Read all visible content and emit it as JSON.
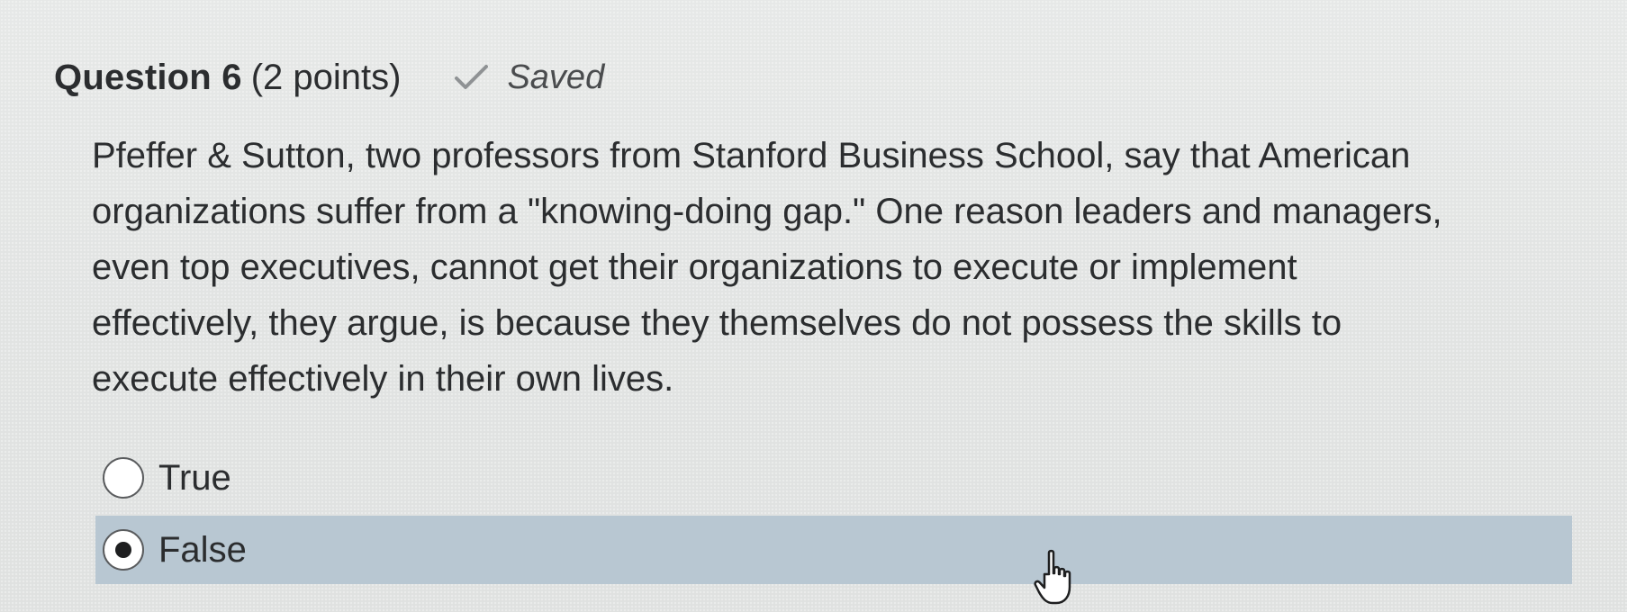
{
  "question": {
    "title": "Question 6",
    "points": "(2 points)",
    "status": "Saved",
    "status_icon": "check-icon",
    "text_lines": [
      "Pfeffer & Sutton, two professors from Stanford Business School, say that American",
      "organizations suffer from a \"knowing-doing gap.\" One reason leaders and managers,",
      "even top executives, cannot get their organizations to execute or implement",
      "effectively, they argue, is because they themselves do not possess the skills to",
      "execute effectively in their own lives."
    ]
  },
  "options": [
    {
      "label": "True",
      "selected": false
    },
    {
      "label": "False",
      "selected": true
    }
  ],
  "colors": {
    "background": "#e3e5e4",
    "selected_row": "#b8c7d2",
    "text": "#2b2d2f"
  },
  "cursor": "hand-pointer-icon"
}
